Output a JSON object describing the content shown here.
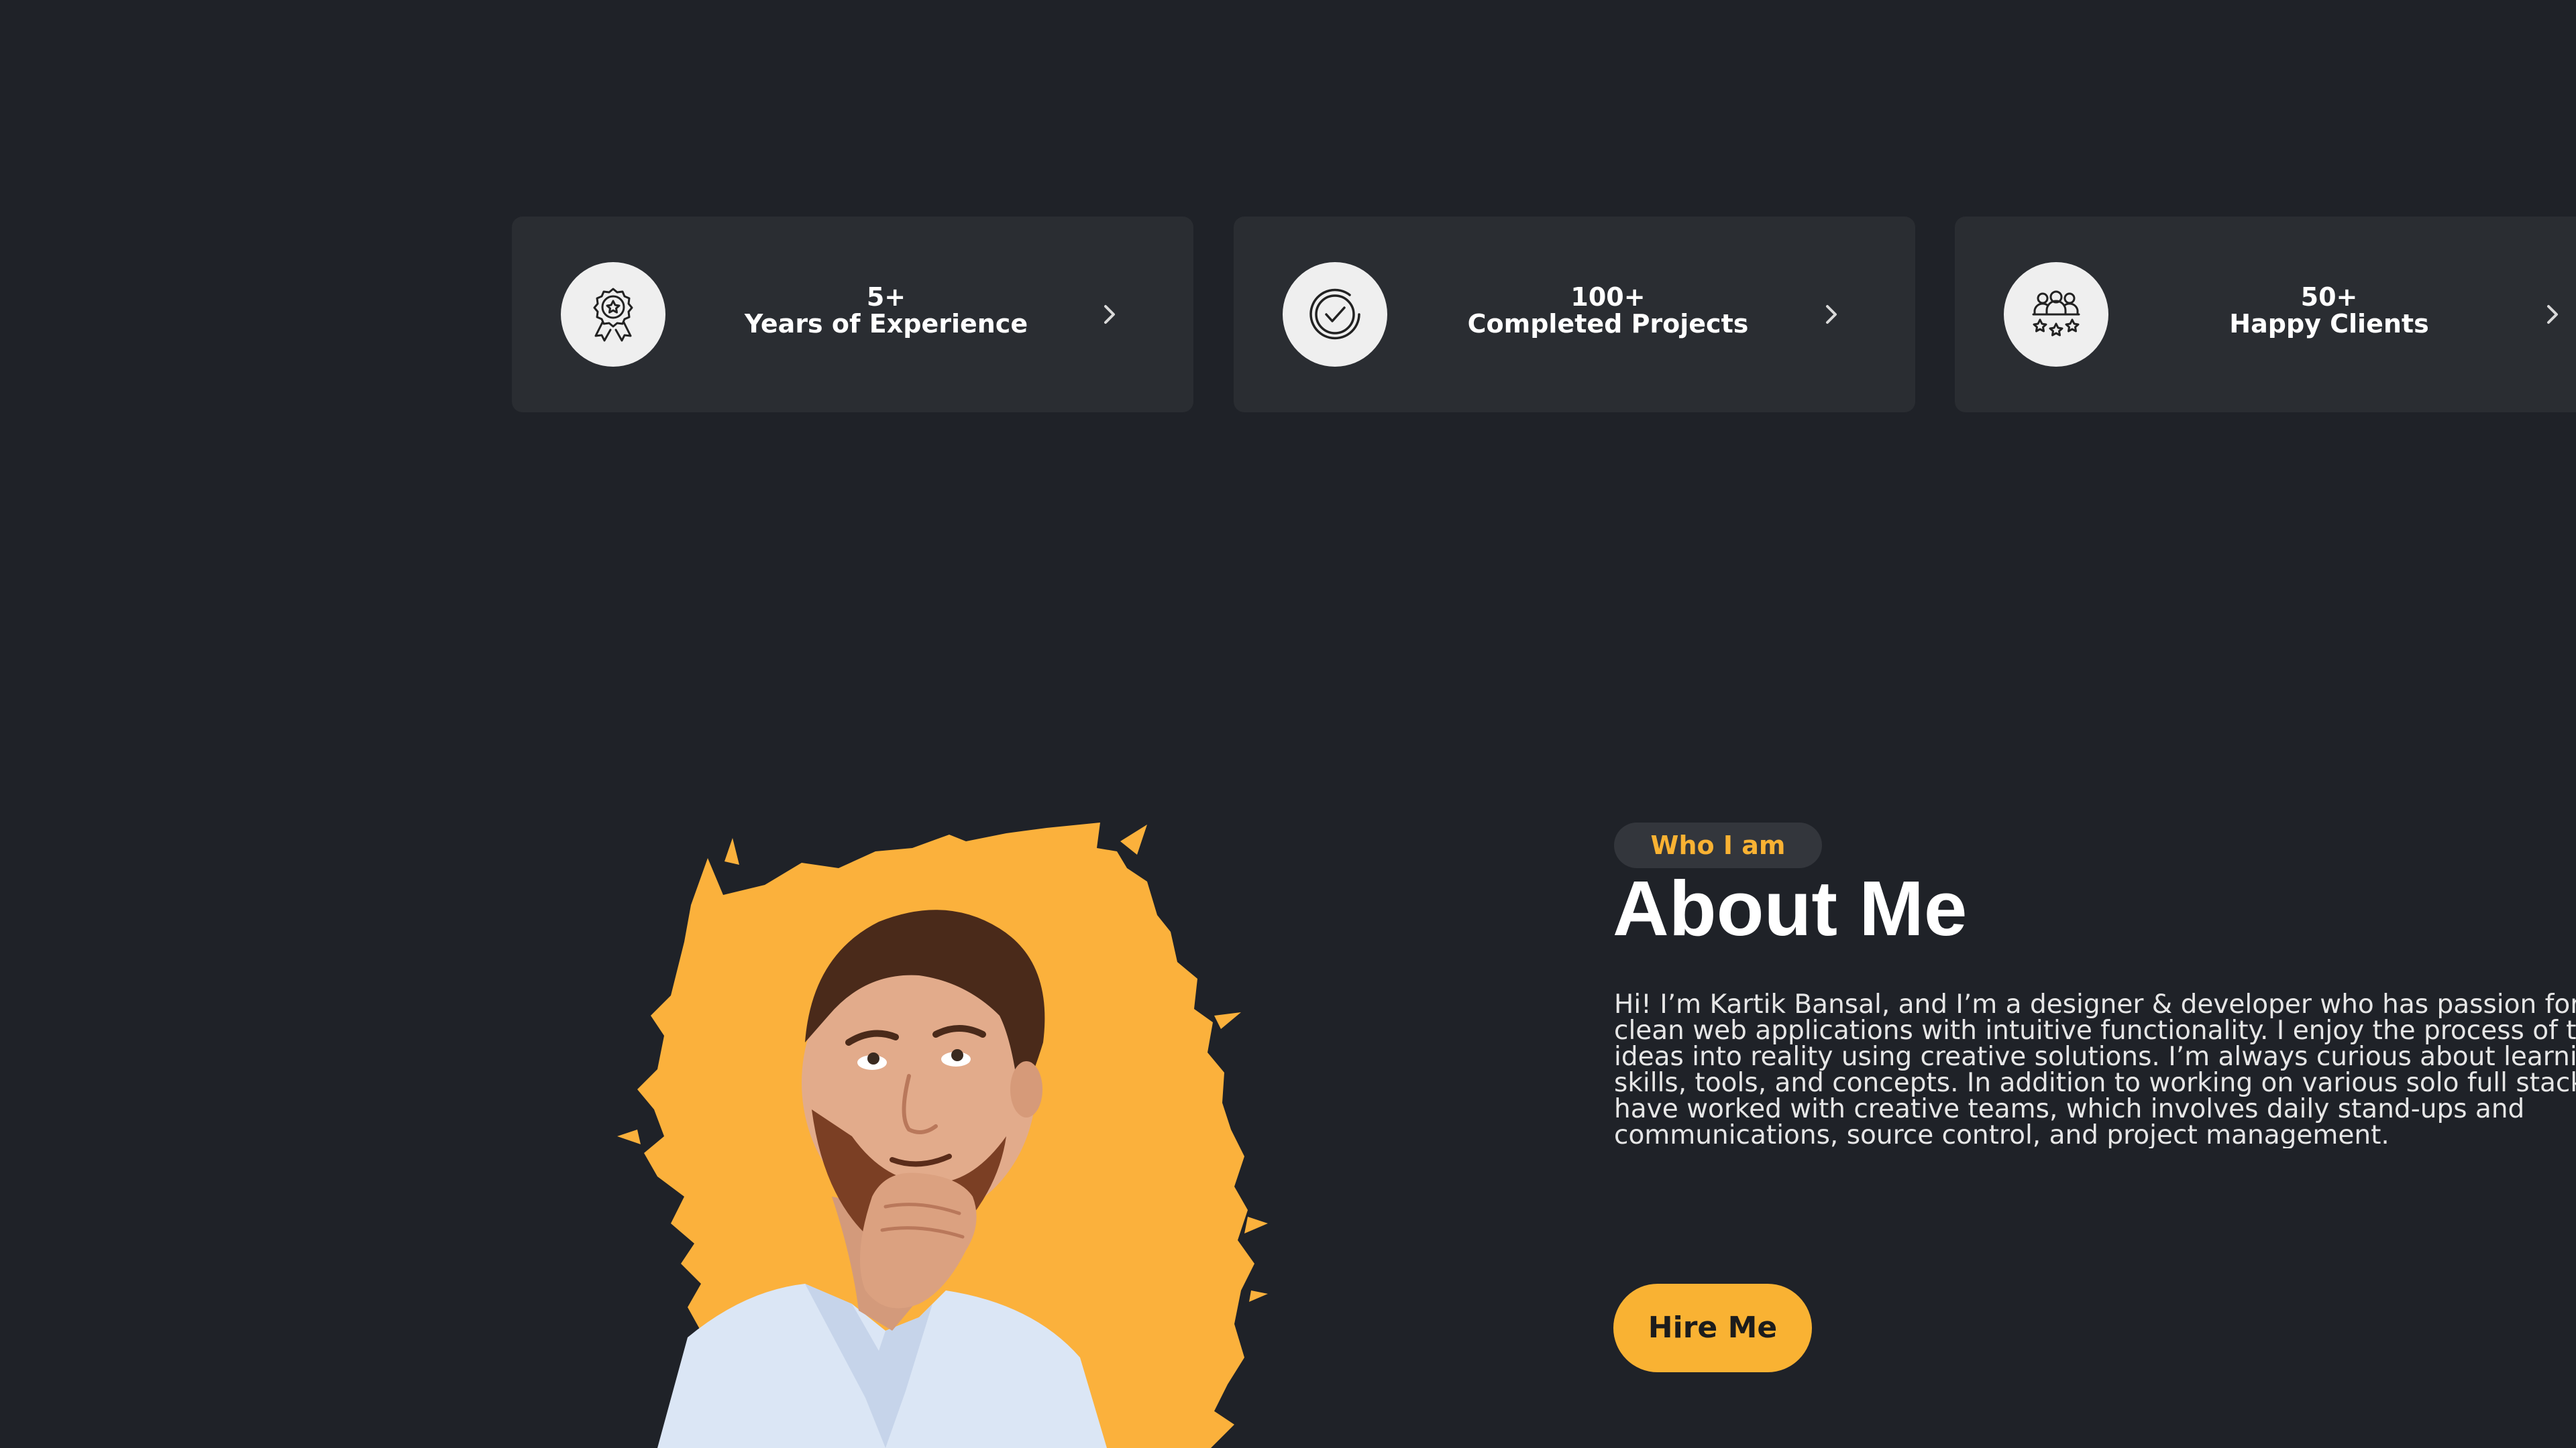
{
  "stats": [
    {
      "value": "5+",
      "label": "Years of Experience",
      "icon": "award-badge-icon"
    },
    {
      "value": "100+",
      "label": "Completed Projects",
      "icon": "check-circle-icon"
    },
    {
      "value": "50+",
      "label": "Happy Clients",
      "icon": "clients-stars-icon"
    }
  ],
  "about": {
    "tag": "Who I am",
    "title": "About Me",
    "lines": [
      "Hi! I’m Kartik Bansal, and I’m a designer & developer who has passion for b",
      "clean web applications with intuitive functionality. I enjoy the process of tu",
      "ideas into reality using creative solutions. I’m always curious about learnin",
      "skills, tools, and concepts. In addition to working on various solo full stack p",
      "have worked with creative teams, which involves daily stand-ups and",
      "communications, source control, and project management."
    ],
    "cta": "Hire Me"
  },
  "colors": {
    "background": "#1f2228",
    "card": "#2a2d32",
    "accent": "#f9b233",
    "pill": "#33363c"
  }
}
